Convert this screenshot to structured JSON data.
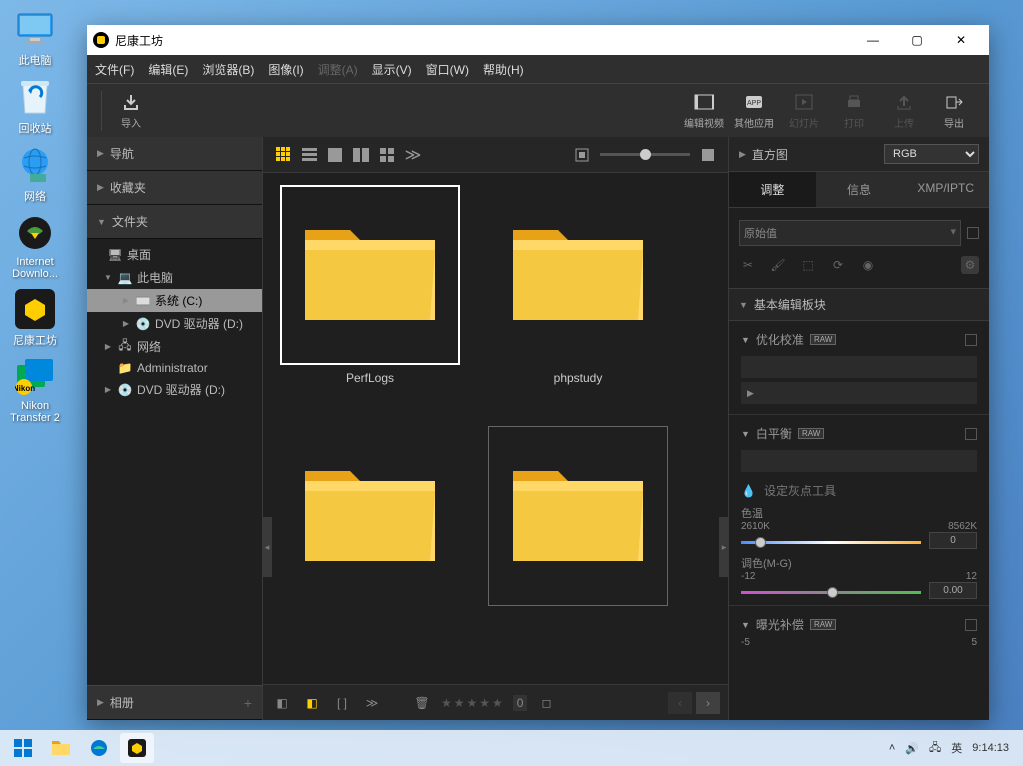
{
  "desktop_icons": [
    {
      "name": "this-pc",
      "label": "此电脑"
    },
    {
      "name": "recycle-bin",
      "label": "回收站"
    },
    {
      "name": "network",
      "label": "网络"
    },
    {
      "name": "idm",
      "label": "Internet Downlo..."
    },
    {
      "name": "nikon-studio",
      "label": "尼康工坊"
    },
    {
      "name": "nikon-transfer",
      "label": "Nikon Transfer 2"
    }
  ],
  "app": {
    "title": "尼康工坊",
    "menu": [
      "文件(F)",
      "编辑(E)",
      "浏览器(B)",
      "图像(I)",
      "调整(A)",
      "显示(V)",
      "窗口(W)",
      "帮助(H)"
    ],
    "menu_disabled_index": 4,
    "toolbar_left": [
      {
        "name": "import",
        "label": "导入"
      }
    ],
    "toolbar_right": [
      {
        "name": "edit-video",
        "label": "编辑视频"
      },
      {
        "name": "other-apps",
        "label": "其他应用"
      },
      {
        "name": "slideshow",
        "label": "幻灯片",
        "disabled": true
      },
      {
        "name": "print",
        "label": "打印",
        "disabled": true
      },
      {
        "name": "upload",
        "label": "上传",
        "disabled": true
      },
      {
        "name": "export",
        "label": "导出"
      }
    ]
  },
  "sidebar": {
    "panels": [
      "导航",
      "收藏夹",
      "文件夹"
    ],
    "tree": [
      {
        "label": "桌面",
        "icon": "desktop",
        "depth": 0,
        "expanded": false
      },
      {
        "label": "此电脑",
        "icon": "pc",
        "depth": 1,
        "expanded": true
      },
      {
        "label": "系统 (C:)",
        "icon": "drive",
        "depth": 2,
        "expanded": false,
        "selected": true
      },
      {
        "label": "DVD 驱动器 (D:)",
        "icon": "dvd",
        "depth": 2,
        "expanded": false
      },
      {
        "label": "网络",
        "icon": "net",
        "depth": 1,
        "expanded": false
      },
      {
        "label": "Administrator",
        "icon": "folder",
        "depth": 1,
        "expanded": false
      },
      {
        "label": "DVD 驱动器 (D:)",
        "icon": "dvd",
        "depth": 1,
        "expanded": false
      }
    ],
    "album": "相册"
  },
  "thumbs": [
    "PerfLogs",
    "phpstudy",
    "",
    ""
  ],
  "thumb_selected": 0,
  "footer": {
    "count": "0"
  },
  "right": {
    "histogram": "直方图",
    "mode": "RGB",
    "tabs": [
      "调整",
      "信息",
      "XMP/IPTC"
    ],
    "active_tab": 0,
    "original": "原始值",
    "section": "基本编辑板块",
    "opt_calib": "优化校准",
    "wb": "白平衡",
    "gray_point": "设定灰点工具",
    "color_temp": "色温",
    "ct_min": "2610K",
    "ct_max": "8562K",
    "ct_val": "0",
    "tint": "调色(M-G)",
    "tint_min": "-12",
    "tint_max": "12",
    "tint_val": "0.00",
    "exposure": "曝光补偿",
    "exp_min": "-5",
    "exp_max": "5",
    "raw": "RAW"
  },
  "taskbar": {
    "ime": "英",
    "time": "9:14:13"
  }
}
